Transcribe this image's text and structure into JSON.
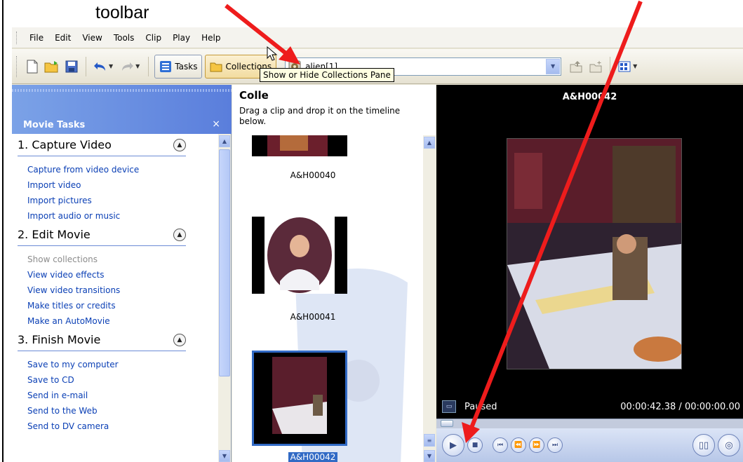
{
  "annotation": {
    "label": "toolbar",
    "arrow_color": "#ee1c1c"
  },
  "menu": [
    "File",
    "Edit",
    "View",
    "Tools",
    "Clip",
    "Play",
    "Help"
  ],
  "toolbar": {
    "tasks_label": "Tasks",
    "collections_label": "Collections",
    "collection_combo_value": "alien[1]",
    "icons": [
      "new-project-icon",
      "open-project-icon",
      "save-project-icon",
      "undo-icon",
      "redo-icon",
      "tasks-icon",
      "collections-folder-icon",
      "up-one-level-icon",
      "new-collection-folder-icon",
      "views-icon"
    ]
  },
  "tooltip": "Show or Hide Collections Pane",
  "tasks_pane": {
    "title": "Movie Tasks",
    "close": "×",
    "sections": [
      {
        "title": "1. Capture Video",
        "items": [
          {
            "label": "Capture from video device",
            "enabled": true
          },
          {
            "label": "Import video",
            "enabled": true
          },
          {
            "label": "Import pictures",
            "enabled": true
          },
          {
            "label": "Import audio or music",
            "enabled": true
          }
        ]
      },
      {
        "title": "2. Edit Movie",
        "items": [
          {
            "label": "Show collections",
            "enabled": false
          },
          {
            "label": "View video effects",
            "enabled": true
          },
          {
            "label": "View video transitions",
            "enabled": true
          },
          {
            "label": "Make titles or credits",
            "enabled": true
          },
          {
            "label": "Make an AutoMovie",
            "enabled": true
          }
        ]
      },
      {
        "title": "3. Finish Movie",
        "items": [
          {
            "label": "Save to my computer",
            "enabled": true
          },
          {
            "label": "Save to CD",
            "enabled": true
          },
          {
            "label": "Send in e-mail",
            "enabled": true
          },
          {
            "label": "Send to the Web",
            "enabled": true
          },
          {
            "label": "Send to DV camera",
            "enabled": true
          }
        ]
      }
    ]
  },
  "collections_pane": {
    "title": "Colle",
    "hint": "Drag a clip and drop it on the timeline below.",
    "clips": [
      {
        "label": "A&H00040",
        "selected": false
      },
      {
        "label": "A&H00041",
        "selected": false
      },
      {
        "label": "A&H00042",
        "selected": true
      }
    ]
  },
  "monitor": {
    "title": "A&H00042",
    "status": "Paused",
    "time": "00:00:42.38 / 00:00:00.00",
    "seek_position": 0.0
  },
  "colors": {
    "xp_blue": "#5a7edc",
    "link_blue": "#0a3fb5",
    "selection": "#316ac5"
  }
}
